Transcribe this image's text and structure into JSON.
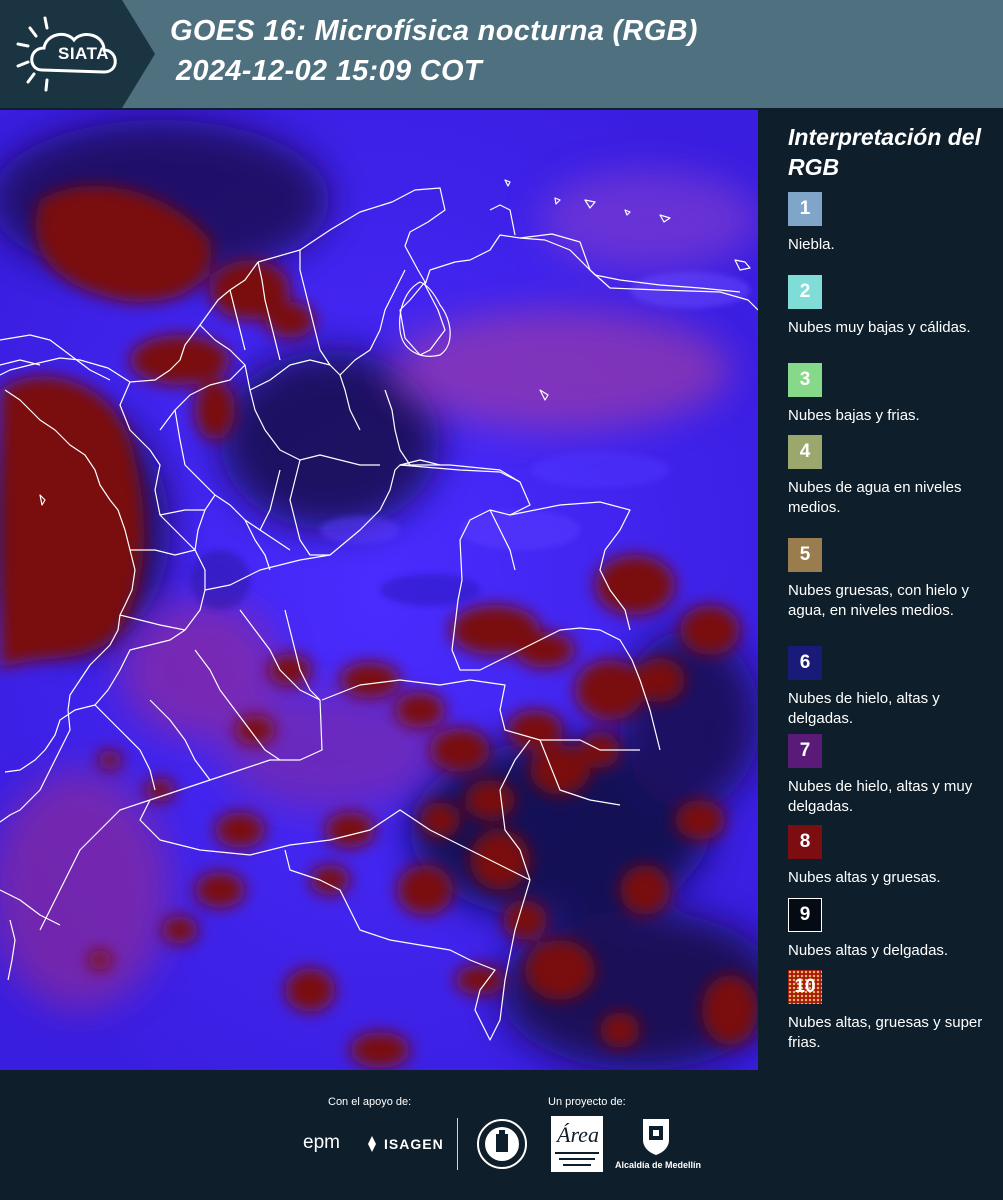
{
  "header": {
    "logo_text": "SIATA",
    "title_line1": "GOES 16: Microfísica nocturna (RGB)",
    "title_line2": "2024-12-02 15:09 COT",
    "background_color": "#4f707f"
  },
  "map": {
    "image_type": "satellite RGB composite",
    "overlay": "country and department boundaries (white lines)"
  },
  "legend": {
    "title": "Interpretación del RGB",
    "items": [
      {
        "number": "1",
        "color": "#7fa6c8",
        "label": "Niebla."
      },
      {
        "number": "2",
        "color": "#7fdcd6",
        "label": "Nubes muy bajas y cálidas."
      },
      {
        "number": "3",
        "color": "#86d989",
        "label": "Nubes bajas y frias."
      },
      {
        "number": "4",
        "color": "#9aa86d",
        "label": "Nubes de agua en niveles medios."
      },
      {
        "number": "5",
        "color": "#9a7d4e",
        "label": "Nubes gruesas, con hielo y agua, en niveles medios."
      },
      {
        "number": "6",
        "color": "#1a1b79",
        "label": "Nubes de hielo, altas y delgadas."
      },
      {
        "number": "7",
        "color": "#5a1a78",
        "label": "Nubes de hielo, altas y muy delgadas."
      },
      {
        "number": "8",
        "color": "#7c0d10",
        "label": "Nubes altas y gruesas."
      },
      {
        "number": "9",
        "color": "#050b14",
        "label": "Nubes altas y delgadas."
      },
      {
        "number": "10",
        "color": "#a81a10",
        "label": "Nubes altas, gruesas y super frias."
      }
    ]
  },
  "footer": {
    "support_label": "Con el apoyo de:",
    "project_label": "Un proyecto de:",
    "sponsor1": "epm",
    "sponsor2": "ISAGEN",
    "partner_city": "Alcaldía de Medellín"
  }
}
